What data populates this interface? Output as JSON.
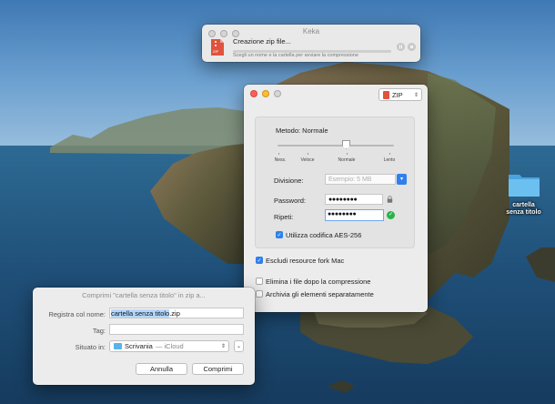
{
  "progress_window": {
    "title": "Keka",
    "status": "Creazione zip file...",
    "hint": "Scegli un nome e la cartella per avviare la compressione",
    "pause_icon": "pause-icon",
    "stop_icon": "stop-icon"
  },
  "keka_window": {
    "format": "ZIP",
    "method_label": "Metodo: Normale",
    "compression_levels": [
      "Ness.",
      "Veloce",
      "Normale",
      "Lento"
    ],
    "selected_level": "Normale",
    "division_label": "Divisione:",
    "division_placeholder": "Esempio: 5 MB",
    "password_label": "Password:",
    "password_value": "●●●●●●●●",
    "repeat_label": "Ripeti:",
    "repeat_value": "●●●●●●●●",
    "aes_label": "Utilizza codifica AES-256",
    "aes_checked": true,
    "fork_label": "Escludi resource fork Mac",
    "fork_checked": true,
    "delete_label": "Elimina i file dopo la compressione",
    "delete_checked": false,
    "separate_label": "Archivia gli elementi separatamente",
    "separate_checked": false
  },
  "save_dialog": {
    "title": "Comprimi \"cartella senza titolo\" in zip a...",
    "name_label": "Registra col nome:",
    "name_selected": "cartella senza titolo",
    "name_ext": ".zip",
    "tag_label": "Tag:",
    "where_label": "Situato in:",
    "where_folder": "Scrivania",
    "where_location": "— iCloud",
    "cancel_label": "Annulla",
    "compress_label": "Comprimi"
  },
  "desktop": {
    "folder_name": "cartella senza titolo"
  },
  "colors": {
    "accent": "#2f80ed",
    "ok_green": "#29b34a",
    "zip_red": "#e0533d",
    "folder_blue": "#58b3ea"
  }
}
